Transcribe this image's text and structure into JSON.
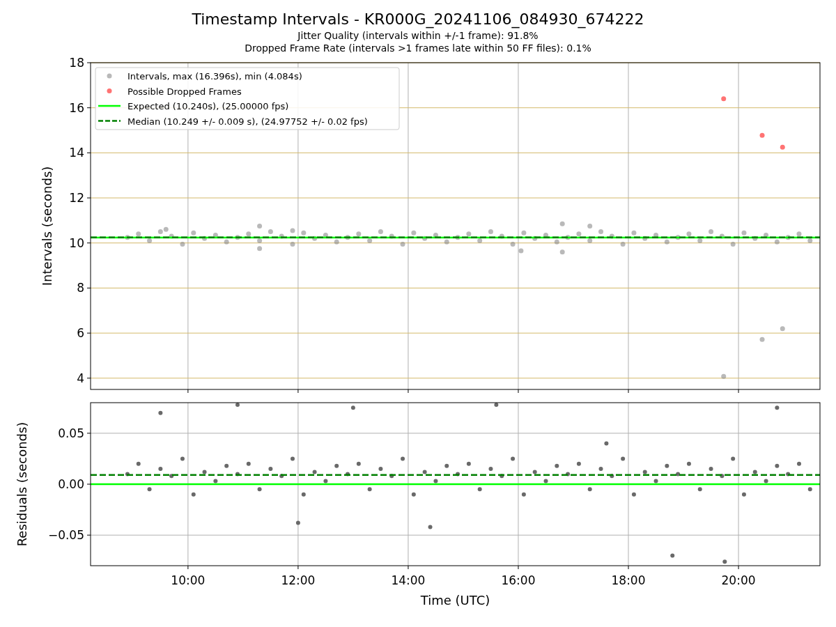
{
  "figure": {
    "title": "Timestamp Intervals - KR000G_20241106_084930_674222",
    "subtitles": [
      "Jitter Quality (intervals within +/-1 frame): 91.8%",
      "Dropped Frame Rate (intervals >1 frames late within 50 FF files): 0.1%"
    ]
  },
  "panels": [
    {
      "chart_data": {
        "type": "scatter",
        "ylabel": "Intervals (seconds)",
        "xlim": [
          8.23,
          21.48
        ],
        "ylim": [
          3.5,
          18
        ],
        "grid": true,
        "legend": "upper left",
        "yticks": [
          {
            "value": 4,
            "label": "4"
          },
          {
            "value": 6,
            "label": "6"
          },
          {
            "value": 8,
            "label": "8"
          },
          {
            "value": 10,
            "label": "10"
          },
          {
            "value": 12,
            "label": "12"
          },
          {
            "value": 14,
            "label": "14"
          },
          {
            "value": 16,
            "label": "16"
          },
          {
            "value": 18,
            "label": "18"
          }
        ],
        "series": [
          {
            "name": "Intervals, max (16.396s), min (4.084s)",
            "color": "#808080",
            "x": [
              8.9,
              9.1,
              9.3,
              9.5,
              9.7,
              9.9,
              10.1,
              10.3,
              10.5,
              10.7,
              10.9,
              11.1,
              11.3,
              11.5,
              11.7,
              11.9,
              12.1,
              12.3,
              12.5,
              12.7,
              12.9,
              13.1,
              13.3,
              13.5,
              13.7,
              13.9,
              14.1,
              14.3,
              14.5,
              14.7,
              14.9,
              15.1,
              15.3,
              15.5,
              15.7,
              15.9,
              16.1,
              16.3,
              16.5,
              16.7,
              16.9,
              17.1,
              17.3,
              17.5,
              17.7,
              17.9,
              18.1,
              18.3,
              18.5,
              18.7,
              18.9,
              19.1,
              19.3,
              19.5,
              19.7,
              19.9,
              20.1,
              20.3,
              20.5,
              20.7,
              20.9,
              21.1,
              21.3,
              9.6,
              11.3,
              11.3,
              11.9,
              16.05,
              16.8,
              16.8,
              17.3,
              19.73,
              20.43,
              20.8
            ],
            "values": [
              10.25,
              10.4,
              10.1,
              10.5,
              10.3,
              9.95,
              10.45,
              10.2,
              10.35,
              10.05,
              10.25,
              10.4,
              10.1,
              10.5,
              10.3,
              9.95,
              10.45,
              10.2,
              10.35,
              10.05,
              10.25,
              10.4,
              10.1,
              10.5,
              10.3,
              9.95,
              10.45,
              10.2,
              10.35,
              10.05,
              10.25,
              10.4,
              10.1,
              10.5,
              10.3,
              9.95,
              10.45,
              10.2,
              10.35,
              10.05,
              10.25,
              10.4,
              10.1,
              10.5,
              10.3,
              9.95,
              10.45,
              10.2,
              10.35,
              10.05,
              10.25,
              10.4,
              10.1,
              10.5,
              10.3,
              9.95,
              10.45,
              10.2,
              10.35,
              10.05,
              10.25,
              10.4,
              10.1,
              10.6,
              10.75,
              9.75,
              10.55,
              9.65,
              10.85,
              9.6,
              10.75,
              4.08,
              5.72,
              6.2
            ]
          },
          {
            "name": "Possible Dropped Frames",
            "color": "#ff0000",
            "x": [
              19.73,
              20.43,
              20.8
            ],
            "values": [
              16.4,
              14.78,
              14.25
            ]
          }
        ],
        "ref_lines": [
          {
            "axis": "y",
            "value": 10.24,
            "label": "Expected (10.240s), (25.00000 fps)",
            "color": "#00ff00"
          },
          {
            "axis": "y",
            "value": 10.249,
            "label": "Median (10.249 +/- 0.009 s), (24.97752 +/- 0.02 fps)",
            "color": "#008000"
          }
        ]
      }
    },
    {
      "chart_data": {
        "type": "scatter",
        "xlabel": "Time (UTC)",
        "ylabel": "Residuals (seconds)",
        "xlim": [
          8.23,
          21.48
        ],
        "ylim": [
          -0.08,
          0.08
        ],
        "grid": true,
        "xticks": [
          {
            "value": 10,
            "label": "10:00"
          },
          {
            "value": 12,
            "label": "12:00"
          },
          {
            "value": 14,
            "label": "14:00"
          },
          {
            "value": 16,
            "label": "16:00"
          },
          {
            "value": 18,
            "label": "18:00"
          },
          {
            "value": 20,
            "label": "20:00"
          }
        ],
        "yticks": [
          {
            "value": 0.05,
            "label": "0.05"
          },
          {
            "value": 0,
            "label": "0.00"
          },
          {
            "value": -0.05,
            "label": "−0.05"
          }
        ],
        "series": [
          {
            "color": "#696969",
            "x": [
              8.9,
              9.1,
              9.3,
              9.5,
              9.7,
              9.9,
              10.1,
              10.3,
              10.5,
              10.7,
              10.9,
              11.1,
              11.3,
              11.5,
              11.7,
              11.9,
              12.1,
              12.3,
              12.5,
              12.7,
              12.9,
              13.1,
              13.3,
              13.5,
              13.7,
              13.9,
              14.1,
              14.3,
              14.5,
              14.7,
              14.9,
              15.1,
              15.3,
              15.5,
              15.7,
              15.9,
              16.1,
              16.3,
              16.5,
              16.7,
              16.9,
              17.1,
              17.3,
              17.5,
              17.7,
              17.9,
              18.1,
              18.3,
              18.5,
              18.7,
              18.9,
              19.1,
              19.3,
              19.5,
              19.7,
              19.9,
              20.1,
              20.3,
              20.5,
              20.7,
              20.9,
              21.1,
              21.3,
              9.5,
              10.9,
              12.0,
              13.0,
              14.4,
              15.6,
              17.6,
              18.8,
              19.75,
              20.7
            ],
            "values": [
              0.01,
              0.02,
              -0.005,
              0.015,
              0.008,
              0.025,
              -0.01,
              0.012,
              0.003,
              0.018,
              0.01,
              0.02,
              -0.005,
              0.015,
              0.008,
              0.025,
              -0.01,
              0.012,
              0.003,
              0.018,
              0.01,
              0.02,
              -0.005,
              0.015,
              0.008,
              0.025,
              -0.01,
              0.012,
              0.003,
              0.018,
              0.01,
              0.02,
              -0.005,
              0.015,
              0.008,
              0.025,
              -0.01,
              0.012,
              0.003,
              0.018,
              0.01,
              0.02,
              -0.005,
              0.015,
              0.008,
              0.025,
              -0.01,
              0.012,
              0.003,
              0.018,
              0.01,
              0.02,
              -0.005,
              0.015,
              0.008,
              0.025,
              -0.01,
              0.012,
              0.003,
              0.018,
              0.01,
              0.02,
              -0.005,
              0.07,
              0.078,
              -0.038,
              0.075,
              -0.042,
              0.078,
              0.04,
              -0.07,
              -0.076,
              0.075
            ]
          }
        ],
        "ref_lines": [
          {
            "axis": "y",
            "value": 0,
            "color": "#00ff00"
          },
          {
            "axis": "y",
            "value": 0.009,
            "color": "#008000"
          }
        ]
      }
    }
  ]
}
